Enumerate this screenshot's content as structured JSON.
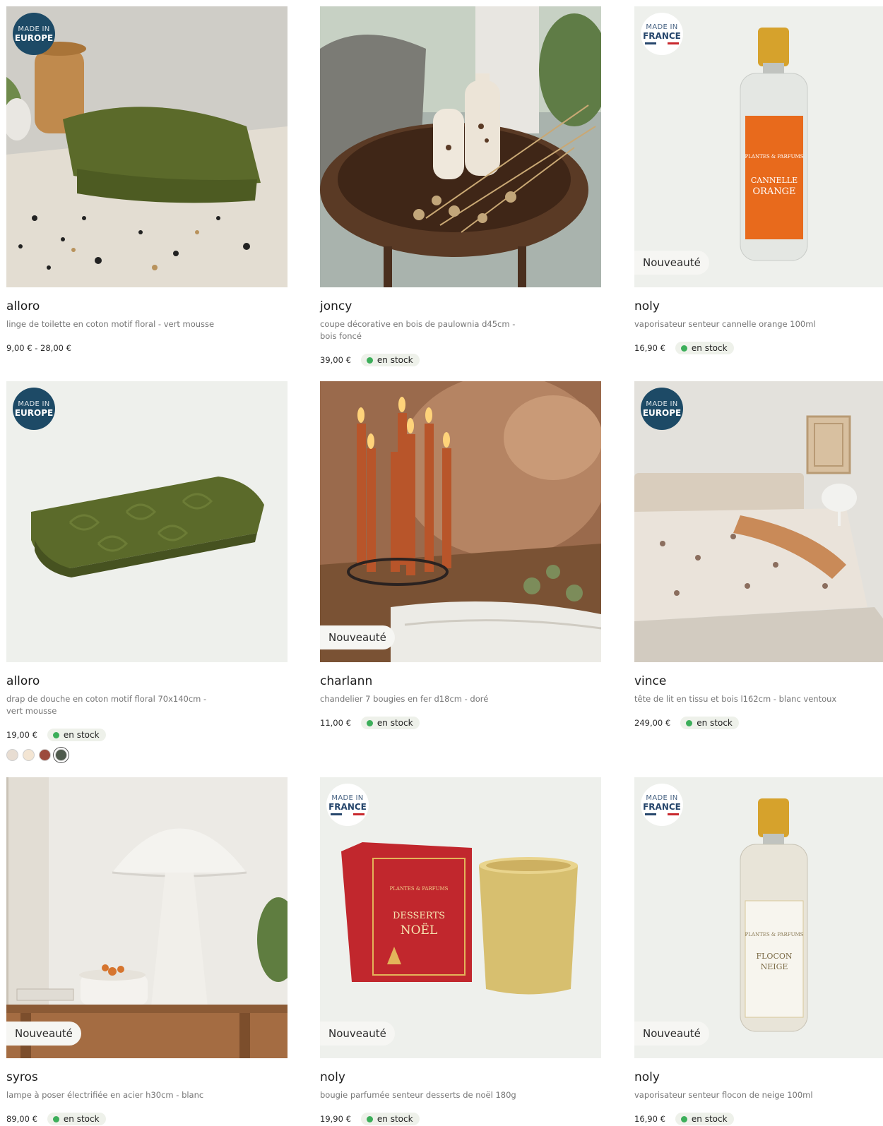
{
  "products": [
    {
      "title": "alloro",
      "desc": "linge de toilette en coton motif floral - vert mousse",
      "price": "9,00 € - 28,00 €",
      "made_line1": "MADE IN",
      "made_line2": "EUROPE",
      "image": "green-towel-on-terrazzo"
    },
    {
      "title": "joncy",
      "desc": "coupe décorative en bois de paulownia d45cm - bois foncé",
      "price": "39,00 €",
      "stock": "en stock",
      "image": "wooden-bowl-with-vases"
    },
    {
      "title": "noly",
      "desc": "vaporisateur senteur cannelle orange 100ml",
      "price": "16,90 €",
      "stock": "en stock",
      "made_line1": "MADE IN",
      "made_line2": "FRANCE",
      "tag": "Nouveauté",
      "image": "orange-room-spray"
    },
    {
      "title": "alloro",
      "desc": "drap de douche en coton motif floral 70x140cm - vert mousse",
      "price": "19,00 €",
      "stock": "en stock",
      "made_line1": "MADE IN",
      "made_line2": "EUROPE",
      "image": "folded-green-towel",
      "swatches": [
        "#e8ddd2",
        "#f3e5d3",
        "#9c4a3c",
        "#4e5a4c"
      ]
    },
    {
      "title": "charlann",
      "desc": "chandelier 7 bougies en fer d18cm - doré",
      "price": "11,00 €",
      "stock": "en stock",
      "tag": "Nouveauté",
      "image": "candle-holder"
    },
    {
      "title": "vince",
      "desc": "tête de lit en tissu et bois l162cm - blanc ventoux",
      "price": "249,00 €",
      "stock": "en stock",
      "made_line1": "MADE IN",
      "made_line2": "EUROPE",
      "image": "bedroom-headboard"
    },
    {
      "title": "syros",
      "desc": "lampe à poser électrifiée en acier h30cm - blanc",
      "price": "89,00 €",
      "stock": "en stock",
      "tag": "Nouveauté",
      "image": "white-mushroom-lamp"
    },
    {
      "title": "noly",
      "desc": "bougie parfumée senteur desserts de noël 180g",
      "price": "19,90 €",
      "stock": "en stock",
      "made_line1": "MADE IN",
      "made_line2": "FRANCE",
      "tag": "Nouveauté",
      "image": "christmas-candle-box",
      "box_brand": "PLANTES & PARFUMS",
      "box_text1": "DESSERTS",
      "box_text2": "NOËL"
    },
    {
      "title": "noly",
      "desc": "vaporisateur senteur flocon de neige 100ml",
      "price": "16,90 €",
      "stock": "en stock",
      "made_line1": "MADE IN",
      "made_line2": "FRANCE",
      "tag": "Nouveauté",
      "image": "white-room-spray"
    }
  ],
  "labels": {
    "bottle1_brand": "PLANTES & PARFUMS",
    "bottle1_line1": "CANNELLE",
    "bottle1_line2": "ORANGE",
    "bottle2_brand": "PLANTES & PARFUMS",
    "bottle2_line1": "FLOCON",
    "bottle2_line2": "NEIGE"
  },
  "colors": {
    "stock_dot": "#3cae5a",
    "europe_badge": "#1d4a66",
    "france_blue": "#26466c",
    "france_red": "#c8282d"
  }
}
